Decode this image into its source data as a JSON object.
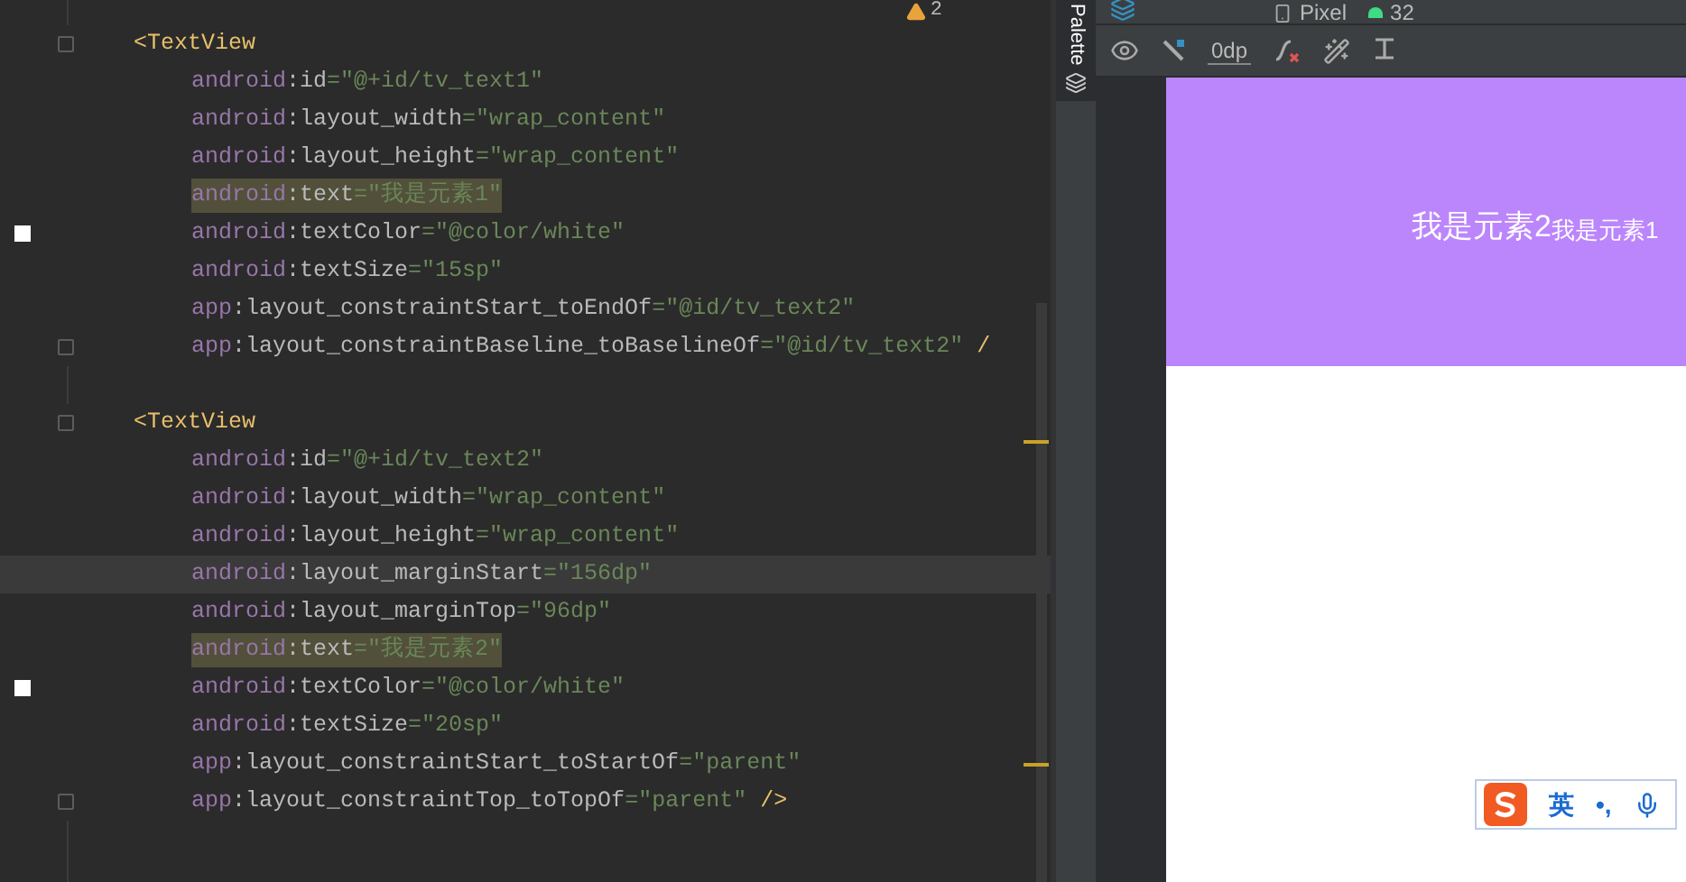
{
  "editor": {
    "warning_count": "2",
    "lines": [
      {
        "kind": "tag",
        "text": "<TextView",
        "fold": true
      },
      {
        "kind": "attr",
        "ns": "android",
        "attr": ":id",
        "value": "=\"@+id/tv_text1\"",
        "highlighted": false,
        "current": false,
        "swatch": false,
        "fold": false
      },
      {
        "kind": "attr",
        "ns": "android",
        "attr": ":layout_width",
        "value": "=\"wrap_content\"",
        "highlighted": false,
        "current": false,
        "swatch": false,
        "fold": false
      },
      {
        "kind": "attr",
        "ns": "android",
        "attr": ":layout_height",
        "value": "=\"wrap_content\"",
        "highlighted": false,
        "current": false,
        "swatch": false,
        "fold": false
      },
      {
        "kind": "attr",
        "ns": "android",
        "attr": ":text",
        "value": "=\"我是元素1\"",
        "highlighted": true,
        "current": false,
        "swatch": false,
        "fold": false
      },
      {
        "kind": "attr",
        "ns": "android",
        "attr": ":textColor",
        "value": "=\"@color/white\"",
        "highlighted": false,
        "current": false,
        "swatch": true,
        "fold": false
      },
      {
        "kind": "attr",
        "ns": "android",
        "attr": ":textSize",
        "value": "=\"15sp\"",
        "highlighted": false,
        "current": false,
        "swatch": false,
        "fold": false
      },
      {
        "kind": "attr",
        "ns": "app",
        "attr": ":layout_constraintStart_toEndOf",
        "value": "=\"@id/tv_text2\"",
        "highlighted": false,
        "current": false,
        "swatch": false,
        "fold": false
      },
      {
        "kind": "attr",
        "ns": "app",
        "attr": ":layout_constraintBaseline_toBaselineOf",
        "value": "=\"@id/tv_text2\"",
        "tail": " /",
        "highlighted": false,
        "current": false,
        "swatch": false,
        "fold": true
      },
      {
        "kind": "blank"
      },
      {
        "kind": "tag",
        "text": "<TextView",
        "fold": true
      },
      {
        "kind": "attr",
        "ns": "android",
        "attr": ":id",
        "value": "=\"@+id/tv_text2\"",
        "highlighted": false,
        "current": false,
        "swatch": false,
        "fold": false
      },
      {
        "kind": "attr",
        "ns": "android",
        "attr": ":layout_width",
        "value": "=\"wrap_content\"",
        "highlighted": false,
        "current": false,
        "swatch": false,
        "fold": false
      },
      {
        "kind": "attr",
        "ns": "android",
        "attr": ":layout_height",
        "value": "=\"wrap_content\"",
        "highlighted": false,
        "current": false,
        "swatch": false,
        "fold": false
      },
      {
        "kind": "attr",
        "ns": "android",
        "attr": ":layout_marginStart",
        "value": "=\"156dp\"",
        "highlighted": false,
        "current": true,
        "swatch": false,
        "fold": false
      },
      {
        "kind": "attr",
        "ns": "android",
        "attr": ":layout_marginTop",
        "value": "=\"96dp\"",
        "highlighted": false,
        "current": false,
        "swatch": false,
        "fold": false
      },
      {
        "kind": "attr",
        "ns": "android",
        "attr": ":text",
        "value": "=\"我是元素2\"",
        "highlighted": true,
        "current": false,
        "swatch": false,
        "fold": false
      },
      {
        "kind": "attr",
        "ns": "android",
        "attr": ":textColor",
        "value": "=\"@color/white\"",
        "highlighted": false,
        "current": false,
        "swatch": true,
        "fold": false
      },
      {
        "kind": "attr",
        "ns": "android",
        "attr": ":textSize",
        "value": "=\"20sp\"",
        "highlighted": false,
        "current": false,
        "swatch": false,
        "fold": false
      },
      {
        "kind": "attr",
        "ns": "app",
        "attr": ":layout_constraintStart_toStartOf",
        "value": "=\"parent\"",
        "highlighted": false,
        "current": false,
        "swatch": false,
        "fold": false
      },
      {
        "kind": "attr",
        "ns": "app",
        "attr": ":layout_constraintTop_toTopOf",
        "value": "=\"parent\"",
        "tail": " />",
        "highlighted": false,
        "current": false,
        "swatch": false,
        "fold": true
      }
    ]
  },
  "palette": {
    "label": "Palette"
  },
  "toolbar": {
    "device": "Pixel",
    "api": "32",
    "margin": "0dp"
  },
  "preview": {
    "text_large": "我是元素2",
    "text_small": "我是元素1"
  },
  "ime": {
    "mode": "英",
    "punct": "•,"
  }
}
